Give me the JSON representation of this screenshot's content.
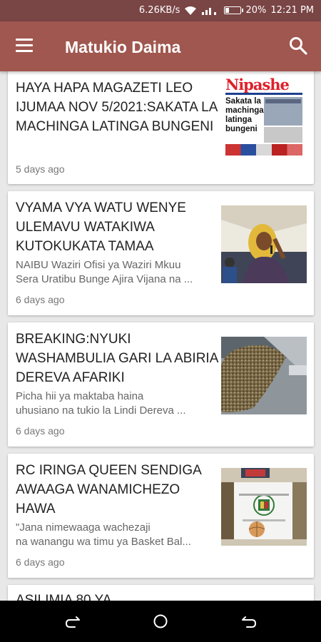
{
  "status": {
    "speed": "6.26KB/s",
    "battery": "20%",
    "time": "12:21 PM"
  },
  "appbar": {
    "title": "Matukio Daima"
  },
  "articles": [
    {
      "title": "HAYA HAPA MAGAZETI LEO IJUMAA NOV 5/2021:SAKATA LA MACHINGA LATINGA BUNGENI",
      "excerpt_lines": [],
      "time": "5 days ago",
      "thumb": "newspaper-front-page",
      "thumb_text": {
        "masthead": "Nipashe",
        "headline": "Sakata la machinga latinga bungeni"
      }
    },
    {
      "title": "VYAMA VYA WATU WENYE ULEMAVU WATAKIWA KUTOKUKATA TAMAA",
      "excerpt_lines": [
        "NAIBU Waziri Ofisi ya Waziri Mkuu",
        "Sera Uratibu Bunge Ajira Vijana na ..."
      ],
      "time": "6 days ago",
      "thumb": "woman-speaking-microphone"
    },
    {
      "title": "BREAKING:NYUKI WASHAMBULIA GARI LA ABIRIA DEREVA AFARIKI",
      "excerpt_lines": [
        "Picha hii ya maktaba haina",
        "uhusiano na tukio la Lindi Dereva ..."
      ],
      "time": "6 days ago",
      "thumb": "bee-swarm-on-car"
    },
    {
      "title": "RC IRINGA QUEEN SENDIGA AWAAGA WANAMICHEZO HAWA",
      "excerpt_lines": [
        "\"Jana nimewaaga wachezaji",
        "na wanangu wa timu ya Basket Bal..."
      ],
      "time": "6 days ago",
      "thumb": "flag-and-basketball"
    },
    {
      "title": "ASILIMIA 80 YA",
      "excerpt_lines": [],
      "time": "",
      "thumb": ""
    }
  ],
  "colors": {
    "status_bar": "#7a4545",
    "app_bar": "#a0574f",
    "background": "#e8e8e8"
  },
  "icons": {
    "menu": "hamburger-menu-icon",
    "search": "search-icon",
    "nav_back": "back-icon",
    "nav_home": "home-icon",
    "nav_recents": "recents-icon"
  }
}
